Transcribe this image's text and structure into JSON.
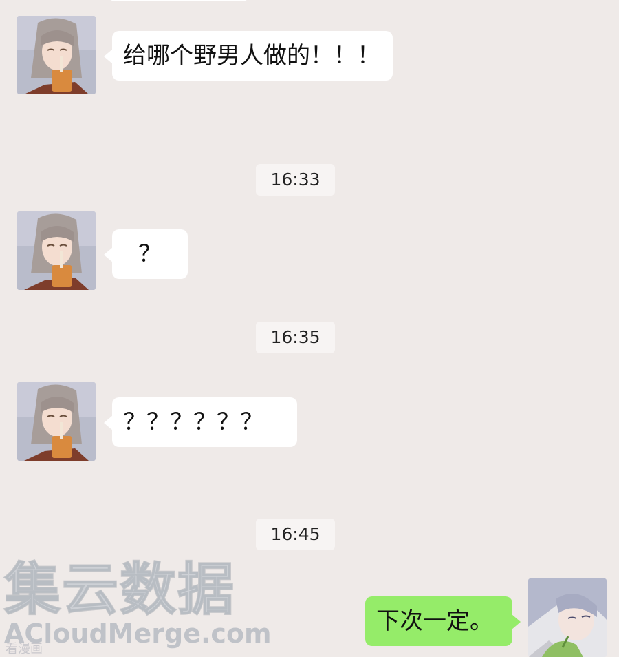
{
  "messages": [
    {
      "side": "left",
      "text": "给哪个野男人做的！！！",
      "avatar": "girl-avatar"
    },
    {
      "side": "left",
      "text": "？",
      "avatar": "girl-avatar"
    },
    {
      "side": "left",
      "text": "？？？？？？",
      "avatar": "girl-avatar"
    },
    {
      "side": "right",
      "text": "下次一定。",
      "avatar": "boy-avatar"
    }
  ],
  "timestamps": [
    "16:33",
    "16:35",
    "16:45"
  ],
  "watermark": {
    "chinese": "集云数据",
    "english": "ACloudMerge.com",
    "small": "看漫画"
  },
  "colors": {
    "background": "#efeae8",
    "incoming_bubble": "#ffffff",
    "outgoing_bubble": "#95ec69"
  }
}
